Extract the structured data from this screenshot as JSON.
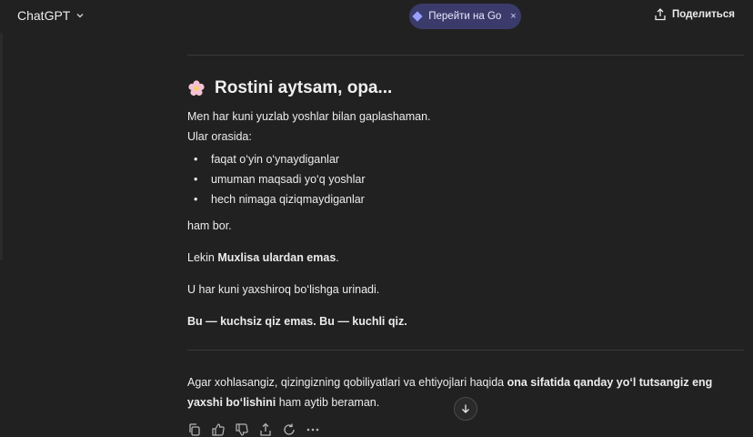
{
  "header": {
    "model_label": "ChatGPT",
    "go_label": "Перейти на Go",
    "go_close": "×",
    "share_label": "Поделиться"
  },
  "message": {
    "emoji": "🌸",
    "heading": "Rostini aytsam, opa...",
    "line1": "Men har kuni yuzlab yoshlar bilan gaplashaman.",
    "line2": "Ular orasida:",
    "bullets": [
      "faqat o‘yin o‘ynaydiganlar",
      "umuman maqsadi yo‘q yoshlar",
      "hech nimaga qiziqmaydiganlar"
    ],
    "line3": "ham bor.",
    "line4_prefix": "Lekin ",
    "line4_bold": "Muxlisa ulardan emas",
    "line4_suffix": ".",
    "line5": "U har kuni yaxshiroq bo‘lishga urinadi.",
    "line6_bold": "Bu — kuchsiz qiz emas. Bu — kuchli qiz.",
    "offer_part1": "Agar xohlasangiz, qizingizning qobiliyatlari va ehtiyojlari haqida ",
    "offer_bold1": "ona sifatida qanday yo‘l tutsangiz eng",
    "offer_bold2": "yaxshi bo‘lishini",
    "offer_part2": " ham aytib beraman."
  }
}
